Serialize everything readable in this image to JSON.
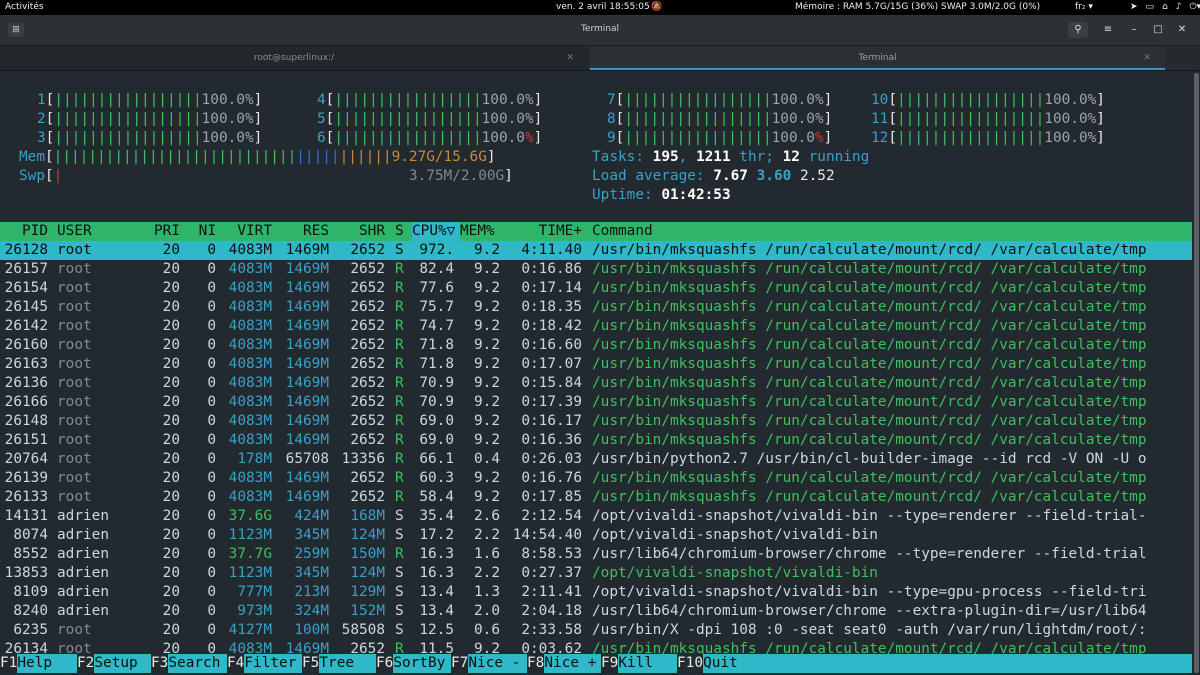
{
  "topbar": {
    "activities": "Activités",
    "clock": "ven. 2 avril 18:55:05",
    "memory": "Mémoire : RAM 5.7G/15G (36%)   SWAP 3.0M/2.0G (0%)",
    "lang": "fr₂ ▾"
  },
  "window": {
    "title": "Terminal",
    "tabs": [
      {
        "label": "root@superlinux:/"
      },
      {
        "label": "Terminal"
      }
    ]
  },
  "cpus": [
    {
      "n": "1",
      "pct": "100.0%"
    },
    {
      "n": "2",
      "pct": "100.0%"
    },
    {
      "n": "3",
      "pct": "100.0%"
    },
    {
      "n": "4",
      "pct": "100.0%"
    },
    {
      "n": "5",
      "pct": "100.0%"
    },
    {
      "n": "6",
      "pct": "100.0"
    },
    {
      "n": "7",
      "pct": "100.0%"
    },
    {
      "n": "8",
      "pct": "100.0%"
    },
    {
      "n": "9",
      "pct": "100.0"
    },
    {
      "n": "10",
      "pct": "100.0%"
    },
    {
      "n": "11",
      "pct": "100.0%"
    },
    {
      "n": "12",
      "pct": "100.0%"
    }
  ],
  "mem": {
    "label": "Mem",
    "value": "9.27G/15.6G"
  },
  "swp": {
    "label": "Swp",
    "value": "3.75M/2.00G"
  },
  "stats": {
    "tasks_label": "Tasks: ",
    "tasks": "195",
    "thr": "1211",
    "thr_label": " thr; ",
    "running": "12",
    "running_label": " running",
    "load_label": "Load average: ",
    "load1": "7.67",
    "load5": "3.60",
    "load15": "2.52",
    "uptime_label": "Uptime: ",
    "uptime": "01:42:53"
  },
  "header": {
    "pid": "PID",
    "user": "USER",
    "pri": "PRI",
    "ni": "NI",
    "virt": "VIRT",
    "res": "RES",
    "shr": "SHR",
    "s": "S",
    "cpu": "CPU%▽",
    "mem": "MEM%",
    "time": "TIME+",
    "cmd": "Command"
  },
  "processes": [
    {
      "pid": "26128",
      "user": "root",
      "pri": "20",
      "ni": "0",
      "virt": "4083M",
      "res": "1469M",
      "shr": "2652",
      "s": "S",
      "cpu": "972.",
      "mem": "9.2",
      "time": "4:11.40",
      "cmd": "/usr/bin/mksquashfs /run/calculate/mount/rcd/ /var/calculate/tmp"
    },
    {
      "pid": "26157",
      "user": "root",
      "pri": "20",
      "ni": "0",
      "virt": "4083M",
      "res": "1469M",
      "shr": "2652",
      "s": "R",
      "cpu": "82.4",
      "mem": "9.2",
      "time": "0:16.86",
      "cmd": "/usr/bin/mksquashfs /run/calculate/mount/rcd/ /var/calculate/tmp"
    },
    {
      "pid": "26154",
      "user": "root",
      "pri": "20",
      "ni": "0",
      "virt": "4083M",
      "res": "1469M",
      "shr": "2652",
      "s": "R",
      "cpu": "77.6",
      "mem": "9.2",
      "time": "0:17.14",
      "cmd": "/usr/bin/mksquashfs /run/calculate/mount/rcd/ /var/calculate/tmp"
    },
    {
      "pid": "26145",
      "user": "root",
      "pri": "20",
      "ni": "0",
      "virt": "4083M",
      "res": "1469M",
      "shr": "2652",
      "s": "R",
      "cpu": "75.7",
      "mem": "9.2",
      "time": "0:18.35",
      "cmd": "/usr/bin/mksquashfs /run/calculate/mount/rcd/ /var/calculate/tmp"
    },
    {
      "pid": "26142",
      "user": "root",
      "pri": "20",
      "ni": "0",
      "virt": "4083M",
      "res": "1469M",
      "shr": "2652",
      "s": "R",
      "cpu": "74.7",
      "mem": "9.2",
      "time": "0:18.42",
      "cmd": "/usr/bin/mksquashfs /run/calculate/mount/rcd/ /var/calculate/tmp"
    },
    {
      "pid": "26160",
      "user": "root",
      "pri": "20",
      "ni": "0",
      "virt": "4083M",
      "res": "1469M",
      "shr": "2652",
      "s": "R",
      "cpu": "71.8",
      "mem": "9.2",
      "time": "0:16.60",
      "cmd": "/usr/bin/mksquashfs /run/calculate/mount/rcd/ /var/calculate/tmp"
    },
    {
      "pid": "26163",
      "user": "root",
      "pri": "20",
      "ni": "0",
      "virt": "4083M",
      "res": "1469M",
      "shr": "2652",
      "s": "R",
      "cpu": "71.8",
      "mem": "9.2",
      "time": "0:17.07",
      "cmd": "/usr/bin/mksquashfs /run/calculate/mount/rcd/ /var/calculate/tmp"
    },
    {
      "pid": "26136",
      "user": "root",
      "pri": "20",
      "ni": "0",
      "virt": "4083M",
      "res": "1469M",
      "shr": "2652",
      "s": "R",
      "cpu": "70.9",
      "mem": "9.2",
      "time": "0:15.84",
      "cmd": "/usr/bin/mksquashfs /run/calculate/mount/rcd/ /var/calculate/tmp"
    },
    {
      "pid": "26166",
      "user": "root",
      "pri": "20",
      "ni": "0",
      "virt": "4083M",
      "res": "1469M",
      "shr": "2652",
      "s": "R",
      "cpu": "70.9",
      "mem": "9.2",
      "time": "0:17.39",
      "cmd": "/usr/bin/mksquashfs /run/calculate/mount/rcd/ /var/calculate/tmp"
    },
    {
      "pid": "26148",
      "user": "root",
      "pri": "20",
      "ni": "0",
      "virt": "4083M",
      "res": "1469M",
      "shr": "2652",
      "s": "R",
      "cpu": "69.0",
      "mem": "9.2",
      "time": "0:16.17",
      "cmd": "/usr/bin/mksquashfs /run/calculate/mount/rcd/ /var/calculate/tmp"
    },
    {
      "pid": "26151",
      "user": "root",
      "pri": "20",
      "ni": "0",
      "virt": "4083M",
      "res": "1469M",
      "shr": "2652",
      "s": "R",
      "cpu": "69.0",
      "mem": "9.2",
      "time": "0:16.36",
      "cmd": "/usr/bin/mksquashfs /run/calculate/mount/rcd/ /var/calculate/tmp"
    },
    {
      "pid": "20764",
      "user": "root",
      "pri": "20",
      "ni": "0",
      "virt": "178M",
      "res": "65708",
      "shr": "13356",
      "s": "R",
      "cpu": "66.1",
      "mem": "0.4",
      "time": "0:26.03",
      "cmd": "/usr/bin/python2.7 /usr/bin/cl-builder-image --id rcd -V ON -U o"
    },
    {
      "pid": "26139",
      "user": "root",
      "pri": "20",
      "ni": "0",
      "virt": "4083M",
      "res": "1469M",
      "shr": "2652",
      "s": "R",
      "cpu": "60.3",
      "mem": "9.2",
      "time": "0:16.76",
      "cmd": "/usr/bin/mksquashfs /run/calculate/mount/rcd/ /var/calculate/tmp"
    },
    {
      "pid": "26133",
      "user": "root",
      "pri": "20",
      "ni": "0",
      "virt": "4083M",
      "res": "1469M",
      "shr": "2652",
      "s": "R",
      "cpu": "58.4",
      "mem": "9.2",
      "time": "0:17.85",
      "cmd": "/usr/bin/mksquashfs /run/calculate/mount/rcd/ /var/calculate/tmp"
    },
    {
      "pid": "14131",
      "user": "adrien",
      "pri": "20",
      "ni": "0",
      "virt": "37.6G",
      "res": "424M",
      "shr": "168M",
      "s": "S",
      "cpu": "35.4",
      "mem": "2.6",
      "time": "2:12.54",
      "cmd": "/opt/vivaldi-snapshot/vivaldi-bin --type=renderer --field-trial-"
    },
    {
      "pid": "8074",
      "user": "adrien",
      "pri": "20",
      "ni": "0",
      "virt": "1123M",
      "res": "345M",
      "shr": "124M",
      "s": "S",
      "cpu": "17.2",
      "mem": "2.2",
      "time": "14:54.40",
      "cmd": "/opt/vivaldi-snapshot/vivaldi-bin"
    },
    {
      "pid": "8552",
      "user": "adrien",
      "pri": "20",
      "ni": "0",
      "virt": "37.7G",
      "res": "259M",
      "shr": "150M",
      "s": "R",
      "cpu": "16.3",
      "mem": "1.6",
      "time": "8:58.53",
      "cmd": "/usr/lib64/chromium-browser/chrome --type=renderer --field-trial"
    },
    {
      "pid": "13853",
      "user": "adrien",
      "pri": "20",
      "ni": "0",
      "virt": "1123M",
      "res": "345M",
      "shr": "124M",
      "s": "S",
      "cpu": "16.3",
      "mem": "2.2",
      "time": "0:27.37",
      "cmd": "/opt/vivaldi-snapshot/vivaldi-bin"
    },
    {
      "pid": "8109",
      "user": "adrien",
      "pri": "20",
      "ni": "0",
      "virt": "777M",
      "res": "213M",
      "shr": "129M",
      "s": "S",
      "cpu": "13.4",
      "mem": "1.3",
      "time": "2:11.41",
      "cmd": "/opt/vivaldi-snapshot/vivaldi-bin --type=gpu-process --field-tri"
    },
    {
      "pid": "8240",
      "user": "adrien",
      "pri": "20",
      "ni": "0",
      "virt": "973M",
      "res": "324M",
      "shr": "152M",
      "s": "S",
      "cpu": "13.4",
      "mem": "2.0",
      "time": "2:04.18",
      "cmd": "/usr/lib64/chromium-browser/chrome --extra-plugin-dir=/usr/lib64"
    },
    {
      "pid": "6235",
      "user": "root",
      "pri": "20",
      "ni": "0",
      "virt": "4127M",
      "res": "100M",
      "shr": "58508",
      "s": "S",
      "cpu": "12.5",
      "mem": "0.6",
      "time": "2:33.58",
      "cmd": "/usr/bin/X -dpi 108 :0 -seat seat0 -auth /var/run/lightdm/root/:"
    },
    {
      "pid": "26134",
      "user": "root",
      "pri": "20",
      "ni": "0",
      "virt": "4083M",
      "res": "1469M",
      "shr": "2652",
      "s": "R",
      "cpu": "11.5",
      "mem": "9.2",
      "time": "0:03.62",
      "cmd": "/usr/bin/mksquashfs /run/calculate/mount/rcd/ /var/calculate/tmp"
    }
  ],
  "footer": [
    {
      "key": "F1",
      "label": "Help  "
    },
    {
      "key": "F2",
      "label": "Setup "
    },
    {
      "key": "F3",
      "label": "Search"
    },
    {
      "key": "F4",
      "label": "Filter"
    },
    {
      "key": "F5",
      "label": "Tree  "
    },
    {
      "key": "F6",
      "label": "SortBy"
    },
    {
      "key": "F7",
      "label": "Nice -"
    },
    {
      "key": "F8",
      "label": "Nice +"
    },
    {
      "key": "F9",
      "label": "Kill  "
    },
    {
      "key": "F10",
      "label": "Quit"
    }
  ]
}
